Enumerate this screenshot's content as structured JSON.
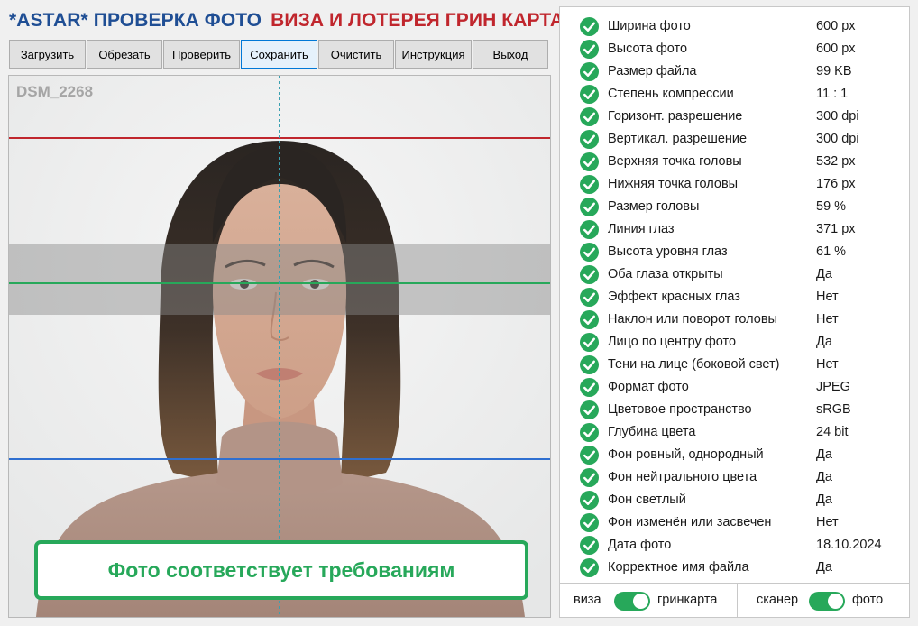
{
  "header": {
    "title_left": "*ASTAR* ПРОВЕРКА ФОТО",
    "title_right": "ВИЗА И ЛОТЕРЕЯ ГРИН КАРТА"
  },
  "toolbar": {
    "load": "Загрузить",
    "crop": "Обрезать",
    "check": "Проверить",
    "save": "Сохранить",
    "clear": "Очистить",
    "instructions": "Инструкция",
    "exit": "Выход"
  },
  "photo": {
    "filename": "DSM_2268",
    "verdict": "Фото соответствует требованиям"
  },
  "checks": [
    {
      "label": "Ширина фото",
      "value": "600 px"
    },
    {
      "label": "Высота фото",
      "value": "600 px"
    },
    {
      "label": "Размер файла",
      "value": "99 KB"
    },
    {
      "label": "Степень компрессии",
      "value": "11 : 1"
    },
    {
      "label": "Горизонт. разрешение",
      "value": "300 dpi"
    },
    {
      "label": "Вертикал. разрешение",
      "value": "300 dpi"
    },
    {
      "label": "Верхняя точка головы",
      "value": "532 px"
    },
    {
      "label": "Нижняя точка головы",
      "value": "176 px"
    },
    {
      "label": "Размер головы",
      "value": "59 %"
    },
    {
      "label": "Линия глаз",
      "value": "371 px"
    },
    {
      "label": "Высота уровня глаз",
      "value": "61 %"
    },
    {
      "label": "Оба глаза открыты",
      "value": "Да"
    },
    {
      "label": "Эффект красных глаз",
      "value": "Нет"
    },
    {
      "label": "Наклон или поворот головы",
      "value": "Нет"
    },
    {
      "label": "Лицо по центру фото",
      "value": "Да"
    },
    {
      "label": "Тени на лице (боковой свет)",
      "value": "Нет"
    },
    {
      "label": "Формат фото",
      "value": "JPEG"
    },
    {
      "label": "Цветовое пространство",
      "value": "sRGB"
    },
    {
      "label": "Глубина цвета",
      "value": "24 bit"
    },
    {
      "label": "Фон ровный, однородный",
      "value": "Да"
    },
    {
      "label": "Фон нейтрального цвета",
      "value": "Да"
    },
    {
      "label": "Фон светлый",
      "value": "Да"
    },
    {
      "label": "Фон изменён или засвечен",
      "value": "Нет"
    },
    {
      "label": "Дата фото",
      "value": "18.10.2024"
    },
    {
      "label": "Корректное имя файла",
      "value": "Да"
    }
  ],
  "toggles": {
    "left_off": "виза",
    "left_on": "гринкарта",
    "left_state": "on",
    "right_off": "сканер",
    "right_on": "фото",
    "right_state": "on"
  },
  "colors": {
    "title_blue": "#1f4e94",
    "title_red": "#c0262d",
    "success_green": "#27a85a",
    "guide_top_red": "#c0262d",
    "guide_eye_green": "#27a85a",
    "guide_chin_blue": "#2f6fd0",
    "guide_center_teal": "#3aa0b0"
  },
  "icons": {
    "check": "check-circle-icon"
  }
}
